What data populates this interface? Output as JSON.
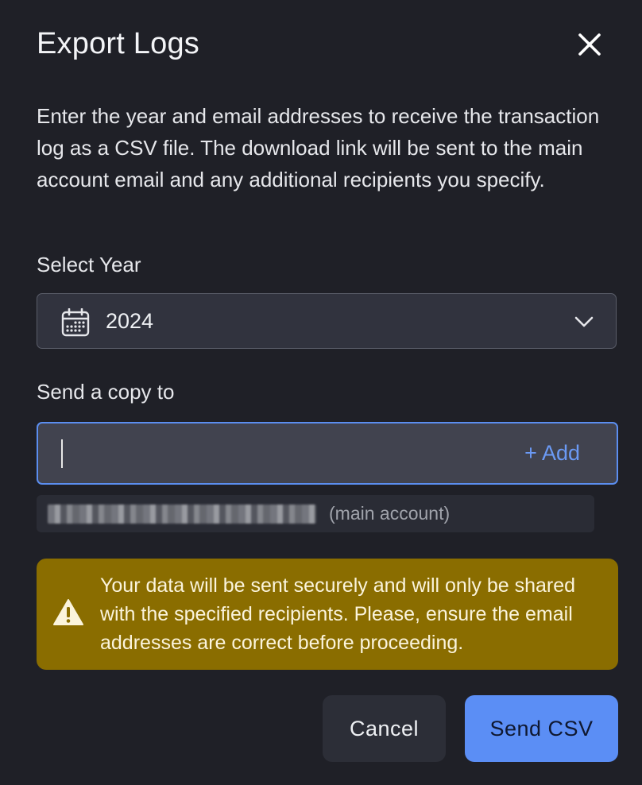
{
  "dialog": {
    "title": "Export Logs",
    "description": "Enter the year and email addresses to receive the transaction log as a CSV file. The download link will be sent to the main account email and any additional recipients you specify."
  },
  "year": {
    "label": "Select Year",
    "value": "2024",
    "icon": "calendar-icon"
  },
  "recipients": {
    "label": "Send a copy to",
    "input_value": "",
    "add_label": "+ Add",
    "main_account_tag": "(main account)"
  },
  "alert": {
    "icon": "warning-icon",
    "text": "Your data will be sent securely and will only be shared with the specified recipients. Please, ensure the email addresses are correct before proceeding.",
    "color": "#8a6d00"
  },
  "actions": {
    "cancel_label": "Cancel",
    "send_label": "Send CSV",
    "accent": "#5b8ef5"
  }
}
